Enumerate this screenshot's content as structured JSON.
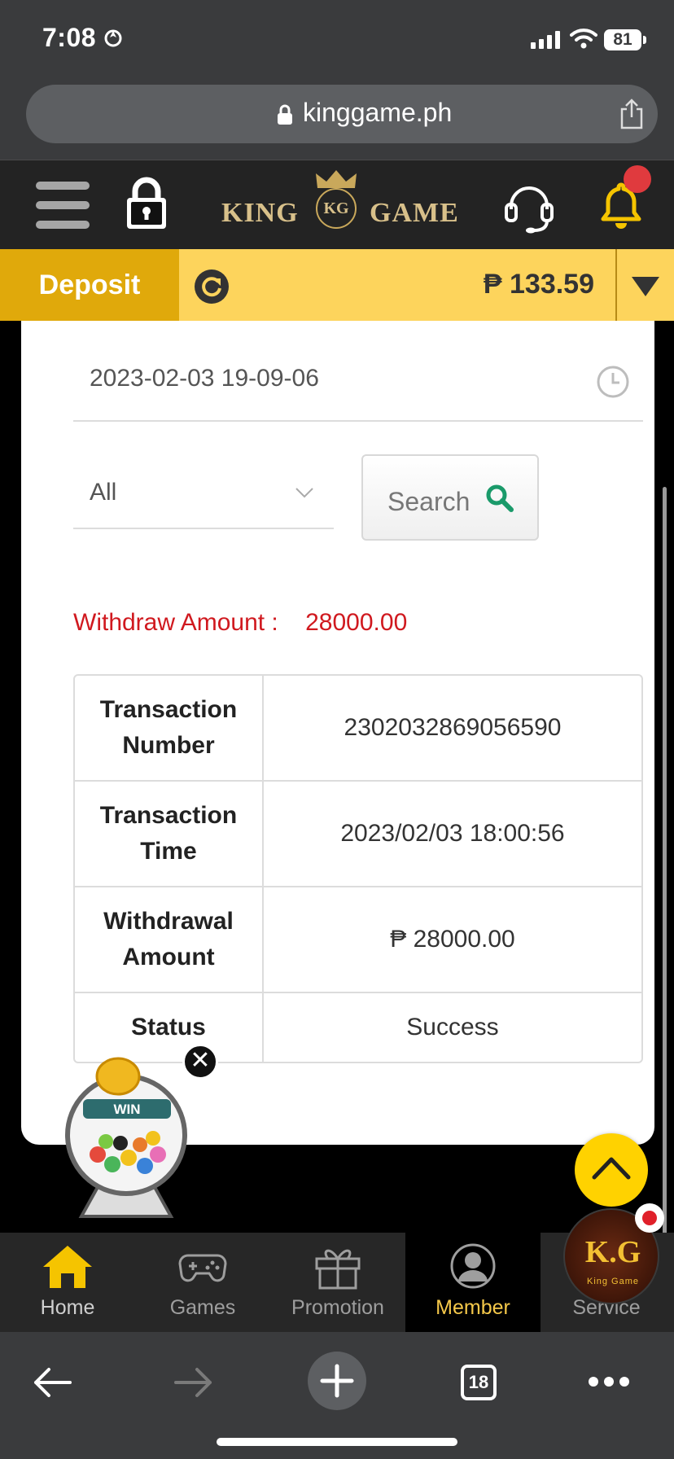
{
  "status_bar": {
    "time": "7:08",
    "battery": "81"
  },
  "browser": {
    "url": "kinggame.ph",
    "tab_count": "18"
  },
  "header": {
    "logo_left": "KING",
    "logo_emblem": "KG",
    "logo_right": "GAME"
  },
  "account_bar": {
    "deposit_label": "Deposit",
    "balance": "₱ 133.59"
  },
  "filters": {
    "date_value": "2023-02-03 19-09-06",
    "type_selected": "All",
    "search_label": "Search"
  },
  "summary": {
    "label": "Withdraw Amount :",
    "value": "28000.00"
  },
  "transaction": {
    "rows": [
      {
        "label": "Transaction Number",
        "value": "2302032869056590"
      },
      {
        "label": "Transaction Time",
        "value": "2023/02/03 18:00:56"
      },
      {
        "label": "Withdrawal Amount",
        "value": "₱ 28000.00"
      },
      {
        "label": "Status",
        "value": "Success"
      }
    ]
  },
  "widgets": {
    "lottery_label": "WIN",
    "close_symbol": "✕",
    "kg_badge": "K.G",
    "kg_badge_sub": "King Game"
  },
  "tabs": [
    {
      "label": "Home",
      "icon": "home-icon"
    },
    {
      "label": "Games",
      "icon": "gamepad-icon"
    },
    {
      "label": "Promotion",
      "icon": "gift-icon"
    },
    {
      "label": "Member",
      "icon": "user-icon"
    },
    {
      "label": "Service",
      "icon": "service-icon"
    }
  ],
  "colors": {
    "deposit_accent": "#e0a90b",
    "balance_bar": "#fdd45c",
    "alert_text": "#d0191f",
    "search_icon": "#1a9a6a",
    "active_tab": "#f5c84a"
  }
}
